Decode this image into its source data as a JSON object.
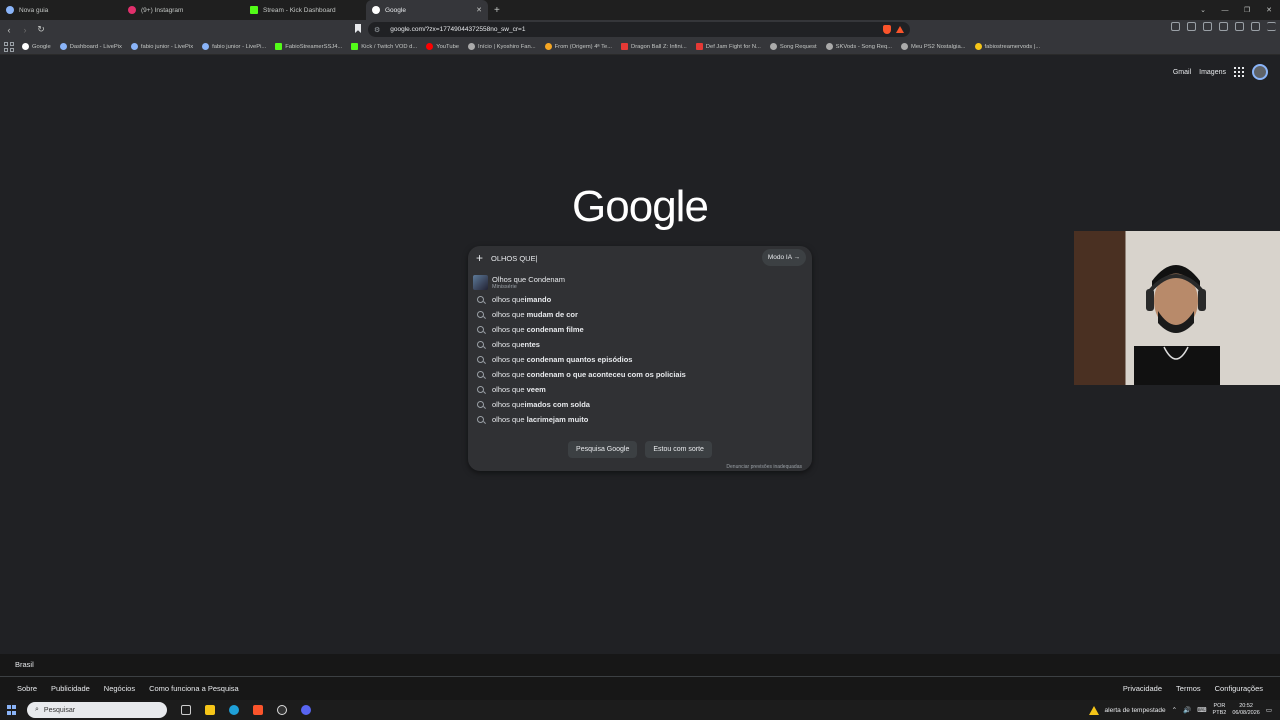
{
  "tabs": [
    {
      "label": "Nova guia",
      "color": "#8ab4f8",
      "active": false
    },
    {
      "label": "(9+) Instagram",
      "color": "#e1306c",
      "active": false
    },
    {
      "label": "Stream - Kick Dashboard",
      "color": "#53fc18",
      "active": false
    },
    {
      "label": "Google",
      "color": "#ffffff",
      "active": true
    }
  ],
  "address": "google.com/?zx=17749044372558no_sw_cr=1",
  "bookmarks": [
    {
      "label": "Google",
      "color": "#ffffff"
    },
    {
      "label": "Dashboard - LivePix",
      "color": "#8ab4f8"
    },
    {
      "label": "fabio junior - LivePix",
      "color": "#8ab4f8"
    },
    {
      "label": "fabio junior - LivePi...",
      "color": "#8ab4f8"
    },
    {
      "label": "FabioStreamerSSJ4...",
      "color": "#53fc18"
    },
    {
      "label": "Kick / Twitch VOD d...",
      "color": "#53fc18"
    },
    {
      "label": "YouTube",
      "color": "#ff0000"
    },
    {
      "label": "Início | Kyoshiro Fan...",
      "color": "#aaaaaa"
    },
    {
      "label": "From (Origem) 4ª Te...",
      "color": "#f5a623"
    },
    {
      "label": "Dragon Ball Z: Infini...",
      "color": "#e53935"
    },
    {
      "label": "Def Jam Fight for N...",
      "color": "#e53935"
    },
    {
      "label": "Song Request",
      "color": "#aaaaaa"
    },
    {
      "label": "SKVods - Song Req...",
      "color": "#aaaaaa"
    },
    {
      "label": "Meu PS2 Nostalgia...",
      "color": "#aaaaaa"
    },
    {
      "label": "fabiostreamervods |...",
      "color": "#f5c518"
    }
  ],
  "header": {
    "gmail": "Gmail",
    "images": "Imagens"
  },
  "logo": "Google",
  "search": {
    "query": "OLHOS QUE|",
    "mode_ia": "Modo IA →",
    "first": {
      "title": "Olhos que Condenam",
      "subtitle": "Minissérie"
    },
    "suggestions": [
      {
        "plain": "olhos que",
        "bold": "imando",
        "joined": true
      },
      {
        "plain": "olhos que ",
        "bold": "mudam de cor"
      },
      {
        "plain": "olhos que ",
        "bold": "condenam filme"
      },
      {
        "plain": "olhos qu",
        "bold": "entes",
        "joined": true
      },
      {
        "plain": "olhos que ",
        "bold": "condenam quantos episódios"
      },
      {
        "plain": "olhos que ",
        "bold": "condenam o que aconteceu com os policiais"
      },
      {
        "plain": "olhos que ",
        "bold": "veem"
      },
      {
        "plain": "olhos que",
        "bold": "imados com solda",
        "joined": true
      },
      {
        "plain": "olhos que ",
        "bold": "lacrimejam muito"
      }
    ],
    "btn_search": "Pesquisa Google",
    "btn_lucky": "Estou com sorte",
    "report": "Denunciar previsões inadequadas"
  },
  "footer": {
    "country": "Brasil",
    "left": [
      "Sobre",
      "Publicidade",
      "Negócios",
      "Como funciona a Pesquisa"
    ],
    "right": [
      "Privacidade",
      "Termos",
      "Configurações"
    ]
  },
  "taskbar": {
    "search_placeholder": "Pesquisar",
    "weather": "alerta de tempestade",
    "lang": "POR",
    "lang2": "PTB2",
    "time": "20:52",
    "date": "06/08/2026"
  }
}
